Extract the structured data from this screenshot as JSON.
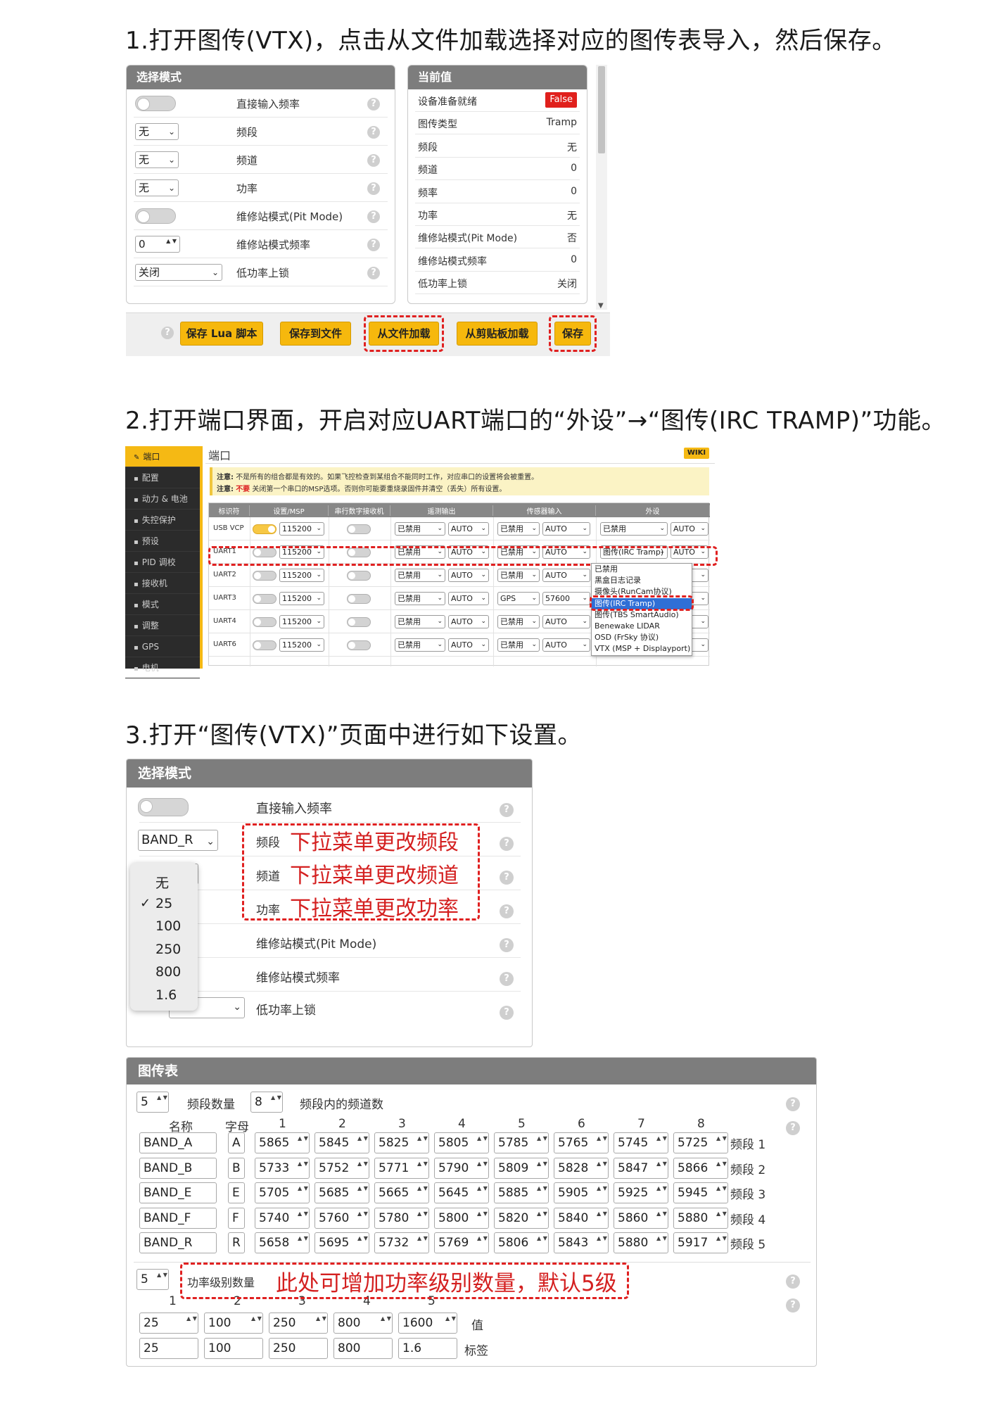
{
  "steps": {
    "s1": "1.打开图传(VTX)，点击从文件加载选择对应的图传表导入，然后保存。",
    "s2": "2.打开端口界面，开启对应UART端口的“外设”→“图传(IRC TRAMP)”功能。",
    "s3": "3.打开“图传(VTX)”页面中进行如下设置。"
  },
  "shot1": {
    "mode_panel": {
      "title": "选择模式",
      "rows": [
        {
          "control": "toggle",
          "label": "直接输入频率"
        },
        {
          "control": "select",
          "value": "无",
          "label": "频段"
        },
        {
          "control": "select",
          "value": "无",
          "label": "频道"
        },
        {
          "control": "select",
          "value": "无",
          "label": "功率"
        },
        {
          "control": "toggle",
          "label": "维修站模式(Pit Mode)"
        },
        {
          "control": "number",
          "value": "0",
          "label": "维修站模式频率"
        },
        {
          "control": "select",
          "value": "关闭",
          "label": "低功率上锁"
        }
      ]
    },
    "current_panel": {
      "title": "当前值",
      "rows": [
        {
          "label": "设备准备就绪",
          "value": "False"
        },
        {
          "label": "图传类型",
          "value": "Tramp"
        },
        {
          "label": "频段",
          "value": "无"
        },
        {
          "label": "频道",
          "value": "0"
        },
        {
          "label": "频率",
          "value": "0"
        },
        {
          "label": "功率",
          "value": "无"
        },
        {
          "label": "维修站模式(Pit Mode)",
          "value": "否"
        },
        {
          "label": "维修站模式频率",
          "value": "0"
        },
        {
          "label": "低功率上锁",
          "value": "关闭"
        }
      ]
    },
    "buttons": {
      "save_lua": "保存 Lua 脚本",
      "save_file": "保存到文件",
      "load_file": "从文件加载",
      "load_clipboard": "从剪贴板加载",
      "save": "保存"
    },
    "colors": {
      "accent": "#f6b80d",
      "false_badge": "#e0201c",
      "highlight": "#e02020"
    }
  },
  "shot2": {
    "sidebar": [
      {
        "icon": "ports-icon",
        "label": "端口"
      },
      {
        "icon": "gear-icon",
        "label": "配置"
      },
      {
        "icon": "battery-icon",
        "label": "动力 & 电池"
      },
      {
        "icon": "shield-icon",
        "label": "失控保护"
      },
      {
        "icon": "preset-icon",
        "label": "预设"
      },
      {
        "icon": "pid-icon",
        "label": "PID 调校"
      },
      {
        "icon": "receiver-icon",
        "label": "接收机"
      },
      {
        "icon": "modes-icon",
        "label": "模式"
      },
      {
        "icon": "adjust-icon",
        "label": "调整"
      },
      {
        "icon": "gps-icon",
        "label": "GPS"
      },
      {
        "icon": "motor-icon",
        "label": "电机"
      }
    ],
    "page_title": "端口",
    "wiki": "WIKI",
    "notice1_prefix": "注意:",
    "notice1": "不是所有的组合都是有效的。如果飞控检查到某组合不能同时工作，对应串口的设置将会被重置。",
    "notice2_prefix": "注意:",
    "notice2_red": "不要",
    "notice2": "关闭第一个串口的MSP选项。否则你可能要重烧录固件并清空（丢失）所有设置。",
    "headers": [
      "标识符",
      "设置/MSP",
      "串行数字接收机",
      "遥测输出",
      "传感器输入",
      "外设"
    ],
    "rows": [
      {
        "id": "USB VCP",
        "msp_on": true,
        "baud": "115200",
        "tele": "已禁用",
        "tele_b": "AUTO",
        "sens": "已禁用",
        "sens_b": "AUTO",
        "peri": "已禁用",
        "peri_b": "AUTO"
      },
      {
        "id": "UART1",
        "msp_on": false,
        "baud": "115200",
        "tele": "已禁用",
        "tele_b": "AUTO",
        "sens": "已禁用",
        "sens_b": "AUTO",
        "peri": "图传(IRC Tramp)",
        "peri_b": "AUTO"
      },
      {
        "id": "UART2",
        "msp_on": false,
        "baud": "115200",
        "tele": "已禁用",
        "tele_b": "AUTO",
        "sens": "已禁用",
        "sens_b": "AUTO",
        "peri": "",
        "peri_b": ""
      },
      {
        "id": "UART3",
        "msp_on": false,
        "baud": "115200",
        "tele": "已禁用",
        "tele_b": "AUTO",
        "sens": "GPS",
        "sens_b": "57600",
        "peri": "",
        "peri_b": ""
      },
      {
        "id": "UART4",
        "msp_on": false,
        "baud": "115200",
        "tele": "已禁用",
        "tele_b": "AUTO",
        "sens": "已禁用",
        "sens_b": "AUTO",
        "peri": "",
        "peri_b": ""
      },
      {
        "id": "UART6",
        "msp_on": false,
        "baud": "115200",
        "tele": "已禁用",
        "tele_b": "AUTO",
        "sens": "已禁用",
        "sens_b": "AUTO",
        "peri": "",
        "peri_b": ""
      }
    ],
    "dropdown": [
      "已禁用",
      "黑盒日志记录",
      "摄像头(RunCam协议)",
      "图传(IRC Tramp)",
      "图传(TBS SmartAudio)",
      "Benewake LIDAR",
      "OSD (FrSky 协议)",
      "VTX (MSP + Displayport)"
    ],
    "dropdown_selected": 3
  },
  "shot3": {
    "mode_panel": {
      "title": "选择模式",
      "direct_freq": "直接输入频率",
      "band_value": "BAND_R",
      "band_label": "频段",
      "channel_label": "频道",
      "power_label": "功率",
      "pit_label": "维修站模式(Pit Mode)",
      "pit_freq_label": "维修站模式频率",
      "lowpower_label": "低功率上锁",
      "note_band": "下拉菜单更改频段",
      "note_channel": "下拉菜单更改频道",
      "note_power": "下拉菜单更改功率",
      "power_menu": [
        "无",
        "25",
        "100",
        "250",
        "800",
        "1.6"
      ],
      "power_checked": "✓",
      "power_selected": 1
    },
    "vtx_table": {
      "title": "图传表",
      "band_count": "5",
      "band_count_label": "频段数量",
      "channel_count": "8",
      "channel_count_label": "频段内的频道数",
      "col_name": "名称",
      "col_letter": "字母",
      "col_nums": [
        "1",
        "2",
        "3",
        "4",
        "5",
        "6",
        "7",
        "8"
      ],
      "bands": [
        {
          "name": "BAND_A",
          "letter": "A",
          "freqs": [
            "5865",
            "5845",
            "5825",
            "5805",
            "5785",
            "5765",
            "5745",
            "5725"
          ],
          "tag": "频段 1"
        },
        {
          "name": "BAND_B",
          "letter": "B",
          "freqs": [
            "5733",
            "5752",
            "5771",
            "5790",
            "5809",
            "5828",
            "5847",
            "5866"
          ],
          "tag": "频段 2"
        },
        {
          "name": "BAND_E",
          "letter": "E",
          "freqs": [
            "5705",
            "5685",
            "5665",
            "5645",
            "5885",
            "5905",
            "5925",
            "5945"
          ],
          "tag": "频段 3"
        },
        {
          "name": "BAND_F",
          "letter": "F",
          "freqs": [
            "5740",
            "5760",
            "5780",
            "5800",
            "5820",
            "5840",
            "5860",
            "5880"
          ],
          "tag": "频段 4"
        },
        {
          "name": "BAND_R",
          "letter": "R",
          "freqs": [
            "5658",
            "5695",
            "5732",
            "5769",
            "5806",
            "5843",
            "5880",
            "5917"
          ],
          "tag": "频段 5"
        }
      ],
      "power_count": "5",
      "power_count_label": "功率级别数量",
      "power_note": "此处可增加功率级别数量，默认5级",
      "power_nums": [
        "1",
        "2",
        "3",
        "4",
        "5"
      ],
      "power_values": [
        "25",
        "100",
        "250",
        "800",
        "1600"
      ],
      "power_values_label": "值",
      "power_labels": [
        "25",
        "100",
        "250",
        "800",
        "1.6"
      ],
      "power_labels_label": "标签"
    }
  }
}
